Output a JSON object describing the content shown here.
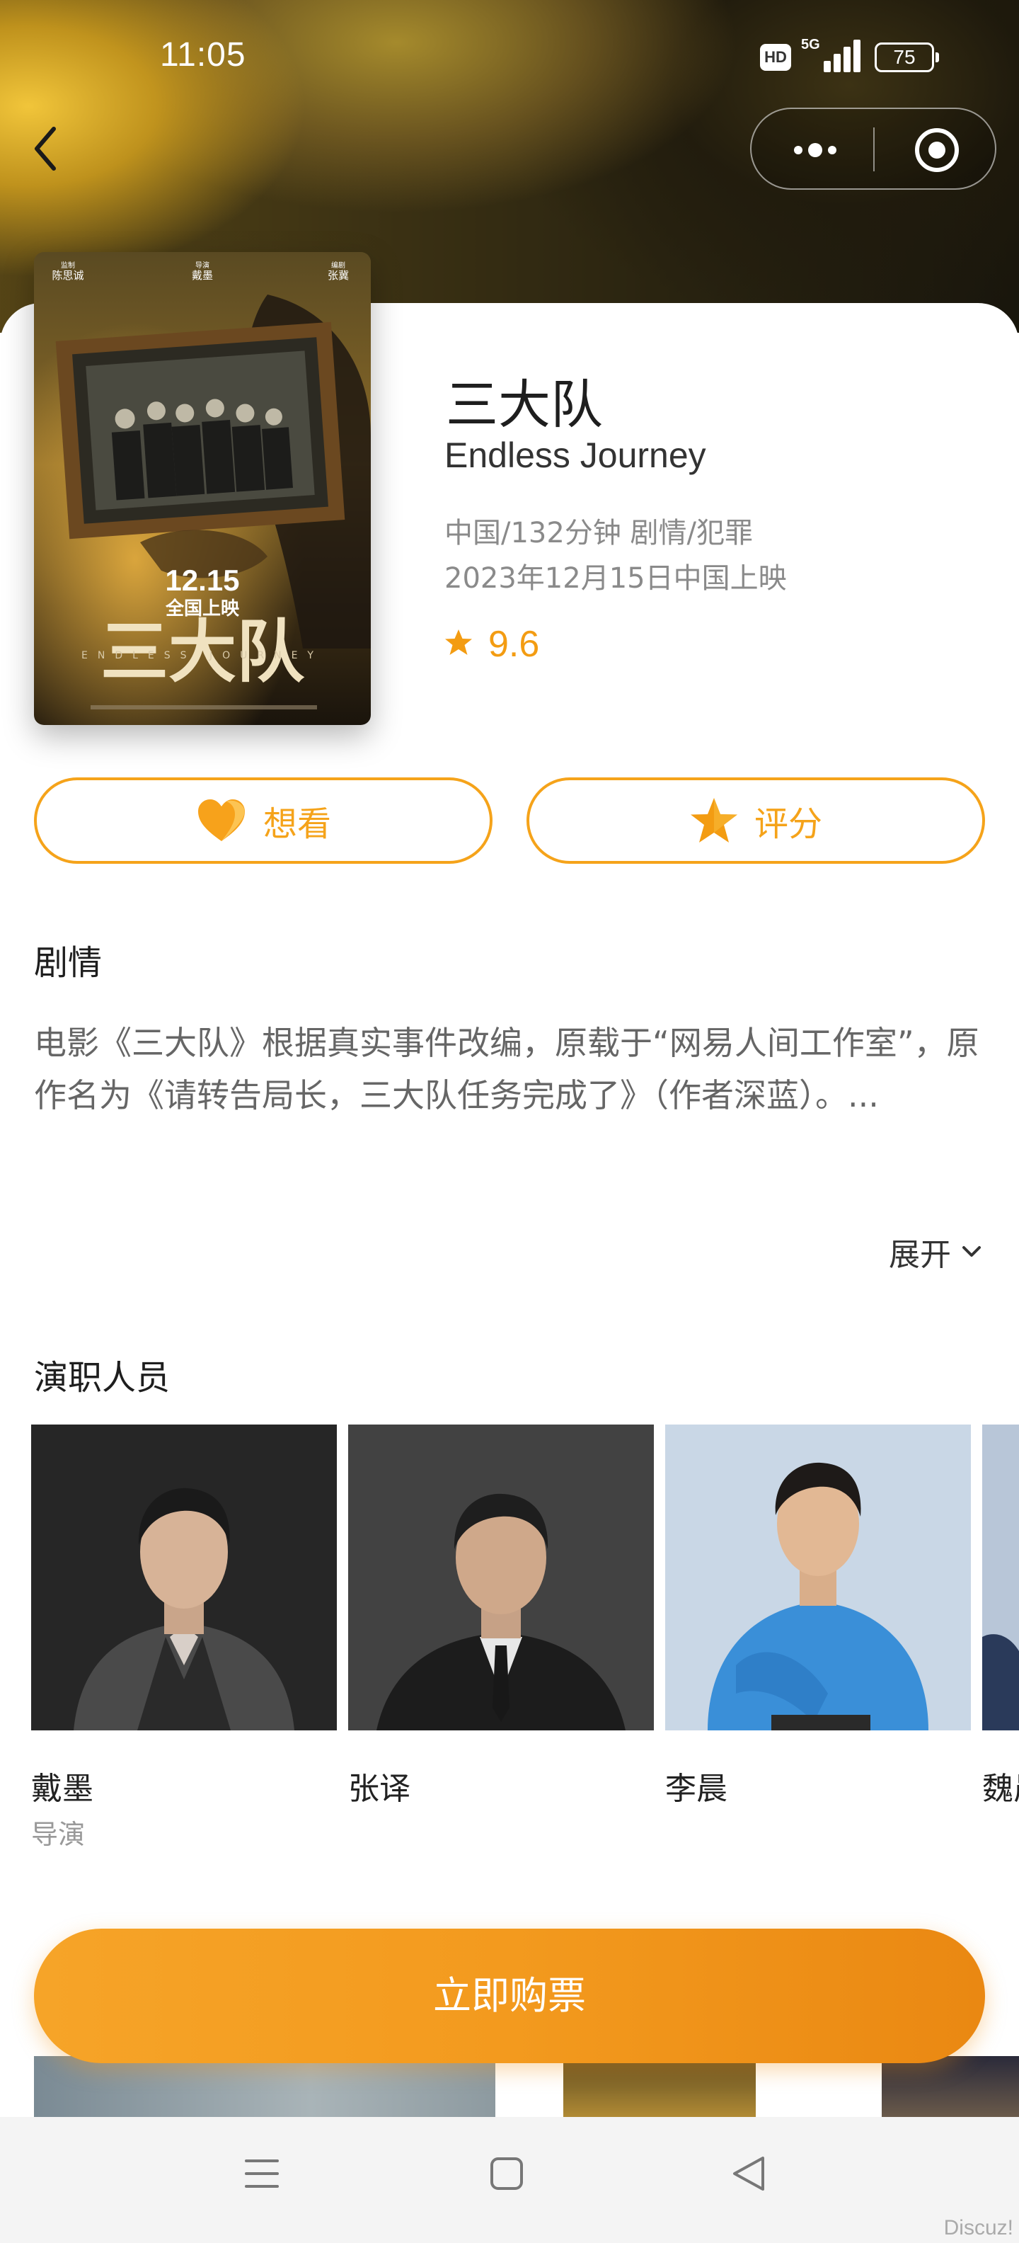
{
  "status_bar": {
    "time": "11:05",
    "hd": "HD",
    "network": "5G",
    "battery": "75"
  },
  "nav": {
    "back_icon": "chevron-left-icon",
    "more_icon": "more-dots-icon",
    "close_icon": "target-circle-icon"
  },
  "poster": {
    "credit_left_role": "监制",
    "credit_left_name": "陈思诚",
    "credit_mid_role": "导演",
    "credit_mid_name": "戴墨",
    "credit_right_role": "编剧",
    "credit_right_name": "张冀",
    "date": "12.15",
    "release": "全国上映",
    "title": "三大队",
    "subtitle": "ENDLESS JOURNEY"
  },
  "movie": {
    "title": "三大队",
    "english_title": "Endless Journey",
    "meta_line1": "中国/132分钟 剧情/犯罪",
    "meta_line2": "2023年12月15日中国上映",
    "rating": "9.6"
  },
  "actions": {
    "want_label": "想看",
    "rate_label": "评分",
    "accent_color": "#f5a31a"
  },
  "plot": {
    "title": "剧情",
    "text": "电影《三大队》根据真实事件改编，原载于“网易人间工作室”，原作名为《请转告局长，三大队任务完成了》（作者深蓝）。...",
    "expand_label": "展开"
  },
  "cast": {
    "title": "演职人员",
    "members": [
      {
        "name": "戴墨",
        "role": "导演"
      },
      {
        "name": "张译",
        "role": ""
      },
      {
        "name": "李晨",
        "role": ""
      },
      {
        "name": "魏晨",
        "role": ""
      }
    ]
  },
  "buy": {
    "label": "立即购票"
  },
  "watermark": "Discuz!"
}
